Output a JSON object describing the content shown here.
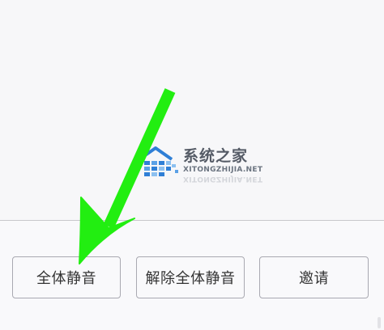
{
  "colors": {
    "arrow": "#22ee11",
    "button_border": "#a9a9b1",
    "button_text": "#333333",
    "background": "#f7f7f9",
    "watermark_blue": "#2f7fd6"
  },
  "bottom_actions": {
    "mute_all_label": "全体静音",
    "unmute_all_label": "解除全体静音",
    "invite_label": "邀请"
  },
  "watermark": {
    "title": "系统之家",
    "subtitle": "XITONGZHIJIA.NET",
    "icon": "house-logo-icon"
  },
  "annotation": {
    "icon": "green-arrow-icon"
  }
}
